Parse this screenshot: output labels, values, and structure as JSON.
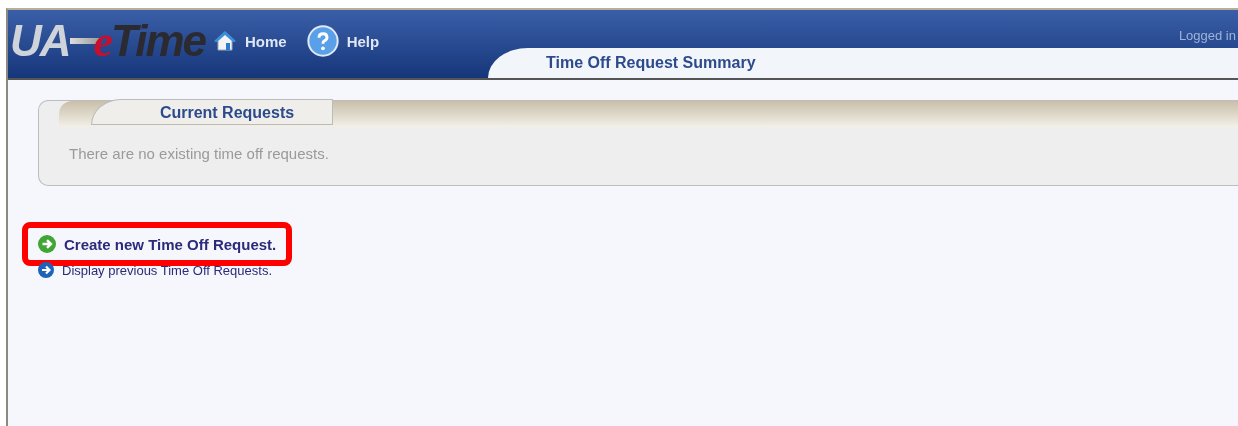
{
  "header": {
    "logo": [
      "UA",
      "e",
      "Time"
    ],
    "nav": [
      {
        "label": "Home",
        "kind": "home"
      },
      {
        "label": "Help",
        "kind": "help"
      }
    ],
    "user_text": "Logged in",
    "page_tab": "Time Off Request Summary"
  },
  "current_requests": {
    "title": "Current Requests",
    "message": "There are no existing time off requests."
  },
  "links": [
    {
      "label": "Create new Time Off Request.",
      "color": "#3fa535",
      "highlighted": true
    },
    {
      "label": "Display previous Time Off Requests.",
      "color": "#1f63b8",
      "highlighted": false
    }
  ]
}
